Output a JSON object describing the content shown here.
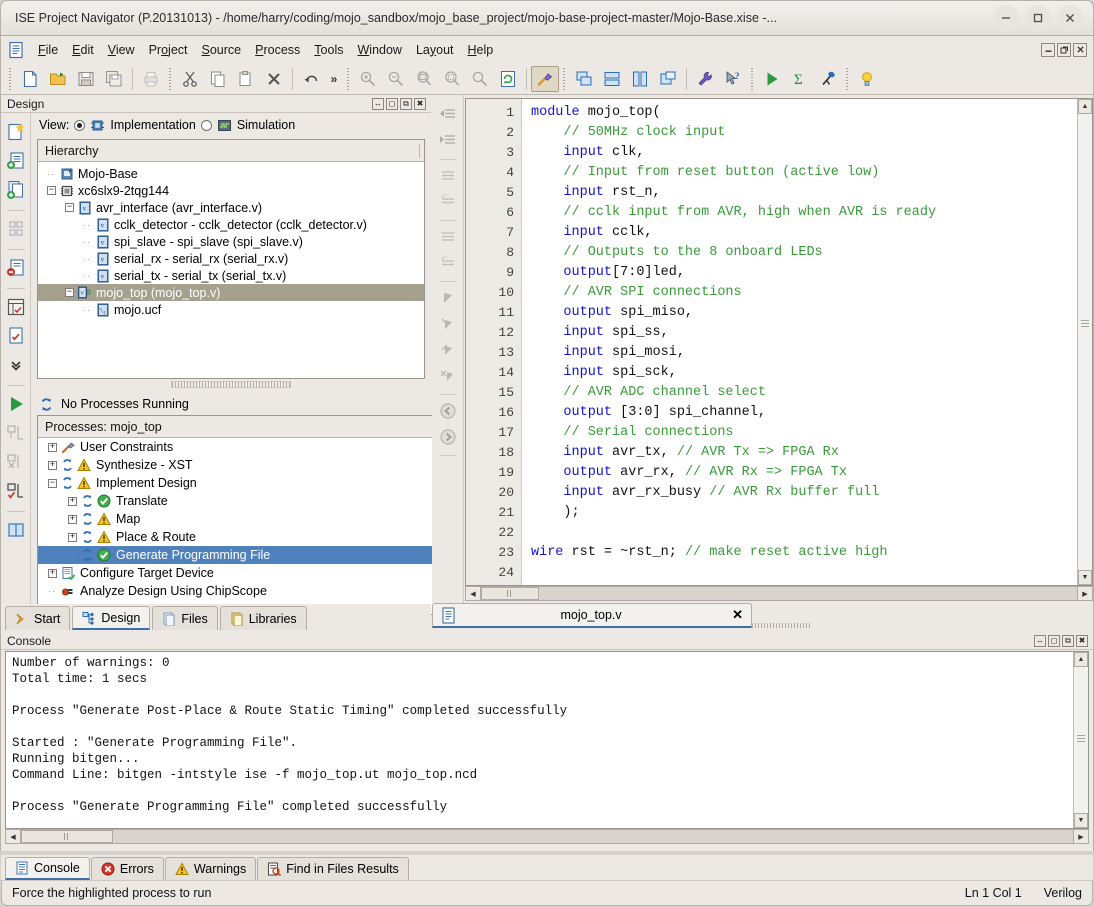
{
  "window": {
    "title": "ISE Project Navigator (P.20131013) - /home/harry/coding/mojo_sandbox/mojo_base_project/mojo-base-project-master/Mojo-Base.xise -...",
    "minimize": "–",
    "maximize": "□",
    "close": "✕"
  },
  "menubar": {
    "items": [
      {
        "label": "File",
        "accel": "F"
      },
      {
        "label": "Edit",
        "accel": "E"
      },
      {
        "label": "View",
        "accel": "V"
      },
      {
        "label": "Project",
        "accel": "o"
      },
      {
        "label": "Source",
        "accel": "S"
      },
      {
        "label": "Process",
        "accel": "P"
      },
      {
        "label": "Tools",
        "accel": "T"
      },
      {
        "label": "Window",
        "accel": "W"
      },
      {
        "label": "Layout",
        "accel": "y"
      },
      {
        "label": "Help",
        "accel": "H"
      }
    ],
    "mdi_buttons": [
      "minimize-mdi",
      "restore-mdi",
      "close-mdi"
    ]
  },
  "toolbar": {
    "groups": [
      [
        "new-file-icon",
        "open-project-icon",
        "save-icon",
        "save-all-icon"
      ],
      [
        "print-icon"
      ],
      [
        "cut-icon",
        "copy-icon",
        "paste-icon",
        "delete-icon"
      ],
      [
        "undo-icon"
      ],
      [
        "overflow-chevron"
      ],
      [
        "zoom-in-icon",
        "zoom-out-icon",
        "zoom-fit-icon",
        "zoom-selection-icon",
        "zoom-area-icon",
        "refresh-icon"
      ],
      [
        "toolbox-hammer-icon"
      ],
      [
        "cascade-windows-icon",
        "tile-horizontally-icon",
        "tile-vertically-icon",
        "new-window-icon"
      ],
      [
        "preferences-wrench-icon",
        "help-pointer-icon"
      ],
      [
        "run-icon",
        "sum-sigma-icon",
        "telescope-icon"
      ],
      [
        "tip-bulb-icon"
      ]
    ]
  },
  "design_panel": {
    "title": "Design",
    "header_icons": [
      "dock-resize-icon",
      "maximize-panel-icon",
      "float-panel-icon",
      "close-panel-icon"
    ],
    "view_label": "View:",
    "view_options": [
      {
        "label": "Implementation",
        "selected": true,
        "icon": "implementation-chip-icon"
      },
      {
        "label": "Simulation",
        "selected": false,
        "icon": "simulation-wave-icon"
      }
    ],
    "hierarchy_header": "Hierarchy",
    "hierarchy": [
      {
        "label": "Mojo-Base",
        "depth": 0,
        "expander": "none",
        "icon": "project-icon",
        "selected": false
      },
      {
        "label": "xc6slx9-2tqg144",
        "depth": 0,
        "expander": "minus",
        "icon": "device-chip-icon",
        "selected": false
      },
      {
        "label": "avr_interface (avr_interface.v)",
        "depth": 1,
        "expander": "minus",
        "icon": "verilog-file-icon",
        "selected": false
      },
      {
        "label": "cclk_detector - cclk_detector (cclk_detector.v)",
        "depth": 2,
        "expander": "none",
        "icon": "verilog-file-icon",
        "selected": false
      },
      {
        "label": "spi_slave - spi_slave (spi_slave.v)",
        "depth": 2,
        "expander": "none",
        "icon": "verilog-file-icon",
        "selected": false
      },
      {
        "label": "serial_rx - serial_rx (serial_rx.v)",
        "depth": 2,
        "expander": "none",
        "icon": "verilog-file-icon",
        "selected": false
      },
      {
        "label": "serial_tx - serial_tx (serial_tx.v)",
        "depth": 2,
        "expander": "none",
        "icon": "verilog-file-icon",
        "selected": false
      },
      {
        "label": "mojo_top (mojo_top.v)",
        "depth": 1,
        "expander": "minus",
        "icon": "verilog-top-module-icon",
        "selected": true
      },
      {
        "label": "mojo.ucf",
        "depth": 2,
        "expander": "none",
        "icon": "ucf-file-icon",
        "selected": false
      }
    ],
    "process_status": "No Processes Running",
    "processes_header": "Processes: mojo_top",
    "processes": [
      {
        "label": "User Constraints",
        "depth": 0,
        "expander": "plus",
        "icons": [
          "constraints-tool-icon"
        ],
        "selected": false
      },
      {
        "label": "Synthesize - XST",
        "depth": 0,
        "expander": "plus",
        "icons": [
          "process-arrows-icon",
          "warning-icon"
        ],
        "selected": false
      },
      {
        "label": "Implement Design",
        "depth": 0,
        "expander": "minus",
        "icons": [
          "process-arrows-icon",
          "warning-icon"
        ],
        "selected": false
      },
      {
        "label": "Translate",
        "depth": 1,
        "expander": "plus",
        "icons": [
          "process-arrows-icon",
          "success-check-icon"
        ],
        "selected": false
      },
      {
        "label": "Map",
        "depth": 1,
        "expander": "plus",
        "icons": [
          "process-arrows-icon",
          "warning-icon"
        ],
        "selected": false
      },
      {
        "label": "Place & Route",
        "depth": 1,
        "expander": "plus",
        "icons": [
          "process-arrows-icon",
          "warning-icon"
        ],
        "selected": false
      },
      {
        "label": "Generate Programming File",
        "depth": 1,
        "expander": "none",
        "icons": [
          "process-arrows-icon",
          "success-check-icon"
        ],
        "selected": true
      },
      {
        "label": "Configure Target Device",
        "depth": 0,
        "expander": "plus",
        "icons": [
          "configure-device-icon"
        ],
        "selected": false
      },
      {
        "label": "Analyze Design Using ChipScope",
        "depth": 0,
        "expander": "none",
        "icons": [
          "chipscope-icon"
        ],
        "selected": false
      }
    ],
    "left_tool_icons": [
      "new-source-icon",
      "add-source-icon",
      "add-copy-source-icon",
      "manage-configurations-icon",
      "remove-source-icon",
      "design-summary-icon",
      "design-properties-icon",
      "more-chevron-icon",
      "run-process-icon",
      "implement-top-module-icon",
      "force-process-rerun-icon",
      "force-process-rerun-all-icon",
      "design-goals-icon"
    ],
    "bottom_tabs": [
      {
        "label": "Start",
        "icon": "start-arrow-icon",
        "active": false
      },
      {
        "label": "Design",
        "icon": "design-hierarchy-icon",
        "active": true
      },
      {
        "label": "Files",
        "icon": "files-icon",
        "active": false
      },
      {
        "label": "Libraries",
        "icon": "libraries-icon",
        "active": false
      }
    ]
  },
  "editor": {
    "tab": {
      "label": "mojo_top.v",
      "icon": "verilog-doc-icon",
      "close": "✕"
    },
    "side_icons": [
      "outdent-icon",
      "indent-icon",
      "comment-block-icon",
      "uncomment-block-icon",
      "comment-line-icon",
      "uncomment-line-icon",
      "bookmark-toggle-icon",
      "bookmark-next-icon",
      "bookmark-prev-icon",
      "bookmark-clear-icon",
      "navigate-back-icon",
      "navigate-forward-icon"
    ],
    "first_line": 1,
    "lines": [
      {
        "n": 1,
        "segs": [
          {
            "t": "module ",
            "c": "kw"
          },
          {
            "t": "mojo_top(",
            "c": ""
          }
        ]
      },
      {
        "n": 2,
        "segs": [
          {
            "t": "    ",
            "c": ""
          },
          {
            "t": "// 50MHz clock input",
            "c": "cm"
          }
        ]
      },
      {
        "n": 3,
        "segs": [
          {
            "t": "    ",
            "c": ""
          },
          {
            "t": "input",
            "c": "kw"
          },
          {
            "t": " clk,",
            "c": ""
          }
        ]
      },
      {
        "n": 4,
        "segs": [
          {
            "t": "    ",
            "c": ""
          },
          {
            "t": "// Input from reset button (active low)",
            "c": "cm"
          }
        ]
      },
      {
        "n": 5,
        "segs": [
          {
            "t": "    ",
            "c": ""
          },
          {
            "t": "input",
            "c": "kw"
          },
          {
            "t": " rst_n,",
            "c": ""
          }
        ]
      },
      {
        "n": 6,
        "segs": [
          {
            "t": "    ",
            "c": ""
          },
          {
            "t": "// cclk input from AVR, high when AVR is ready",
            "c": "cm"
          }
        ]
      },
      {
        "n": 7,
        "segs": [
          {
            "t": "    ",
            "c": ""
          },
          {
            "t": "input",
            "c": "kw"
          },
          {
            "t": " cclk,",
            "c": ""
          }
        ]
      },
      {
        "n": 8,
        "segs": [
          {
            "t": "    ",
            "c": ""
          },
          {
            "t": "// Outputs to the 8 onboard LEDs",
            "c": "cm"
          }
        ]
      },
      {
        "n": 9,
        "segs": [
          {
            "t": "    ",
            "c": ""
          },
          {
            "t": "output",
            "c": "kw"
          },
          {
            "t": "[7:0]led,",
            "c": ""
          }
        ]
      },
      {
        "n": 10,
        "segs": [
          {
            "t": "    ",
            "c": ""
          },
          {
            "t": "// AVR SPI connections",
            "c": "cm"
          }
        ]
      },
      {
        "n": 11,
        "segs": [
          {
            "t": "    ",
            "c": ""
          },
          {
            "t": "output",
            "c": "kw"
          },
          {
            "t": " spi_miso,",
            "c": ""
          }
        ]
      },
      {
        "n": 12,
        "segs": [
          {
            "t": "    ",
            "c": ""
          },
          {
            "t": "input",
            "c": "kw"
          },
          {
            "t": " spi_ss,",
            "c": ""
          }
        ]
      },
      {
        "n": 13,
        "segs": [
          {
            "t": "    ",
            "c": ""
          },
          {
            "t": "input",
            "c": "kw"
          },
          {
            "t": " spi_mosi,",
            "c": ""
          }
        ]
      },
      {
        "n": 14,
        "segs": [
          {
            "t": "    ",
            "c": ""
          },
          {
            "t": "input",
            "c": "kw"
          },
          {
            "t": " spi_sck,",
            "c": ""
          }
        ]
      },
      {
        "n": 15,
        "segs": [
          {
            "t": "    ",
            "c": ""
          },
          {
            "t": "// AVR ADC channel select",
            "c": "cm"
          }
        ]
      },
      {
        "n": 16,
        "segs": [
          {
            "t": "    ",
            "c": ""
          },
          {
            "t": "output",
            "c": "kw"
          },
          {
            "t": " [3:0] spi_channel,",
            "c": ""
          }
        ]
      },
      {
        "n": 17,
        "segs": [
          {
            "t": "    ",
            "c": ""
          },
          {
            "t": "// Serial connections",
            "c": "cm"
          }
        ]
      },
      {
        "n": 18,
        "segs": [
          {
            "t": "    ",
            "c": ""
          },
          {
            "t": "input",
            "c": "kw"
          },
          {
            "t": " avr_tx, ",
            "c": ""
          },
          {
            "t": "// AVR Tx => FPGA Rx",
            "c": "cm"
          }
        ]
      },
      {
        "n": 19,
        "segs": [
          {
            "t": "    ",
            "c": ""
          },
          {
            "t": "output",
            "c": "kw"
          },
          {
            "t": " avr_rx, ",
            "c": ""
          },
          {
            "t": "// AVR Rx => FPGA Tx",
            "c": "cm"
          }
        ]
      },
      {
        "n": 20,
        "segs": [
          {
            "t": "    ",
            "c": ""
          },
          {
            "t": "input",
            "c": "kw"
          },
          {
            "t": " avr_rx_busy ",
            "c": ""
          },
          {
            "t": "// AVR Rx buffer full",
            "c": "cm"
          }
        ]
      },
      {
        "n": 21,
        "segs": [
          {
            "t": "    );",
            "c": ""
          }
        ]
      },
      {
        "n": 22,
        "segs": [
          {
            "t": "",
            "c": ""
          }
        ]
      },
      {
        "n": 23,
        "segs": [
          {
            "t": "wire",
            "c": "kw"
          },
          {
            "t": " rst = ~rst_n; ",
            "c": ""
          },
          {
            "t": "// make reset active high",
            "c": "cm"
          }
        ]
      },
      {
        "n": 24,
        "segs": [
          {
            "t": "",
            "c": ""
          }
        ]
      }
    ]
  },
  "console": {
    "title": "Console",
    "header_icons": [
      "dock-resize-icon",
      "maximize-panel-icon",
      "float-panel-icon",
      "close-panel-icon"
    ],
    "text": "Number of warnings: 0\nTotal time: 1 secs\n\nProcess \"Generate Post-Place & Route Static Timing\" completed successfully\n\nStarted : \"Generate Programming File\".\nRunning bitgen...\nCommand Line: bitgen -intstyle ise -f mojo_top.ut mojo_top.ncd\n\nProcess \"Generate Programming File\" completed successfully\n",
    "tabs": [
      {
        "label": "Console",
        "icon": "console-icon",
        "active": true
      },
      {
        "label": "Errors",
        "icon": "error-icon",
        "active": false
      },
      {
        "label": "Warnings",
        "icon": "warning-icon",
        "active": false
      },
      {
        "label": "Find in Files Results",
        "icon": "find-in-files-icon",
        "active": false
      }
    ]
  },
  "statusbar": {
    "message": "Force the highlighted process to run",
    "position": "Ln 1 Col 1",
    "language": "Verilog"
  },
  "colors": {
    "accent_blue": "#4f81bd",
    "selected_tree": "#a6a08e",
    "keyword": "#1414cc",
    "comment": "#3a9a3a",
    "chrome": "#ece9e4"
  }
}
